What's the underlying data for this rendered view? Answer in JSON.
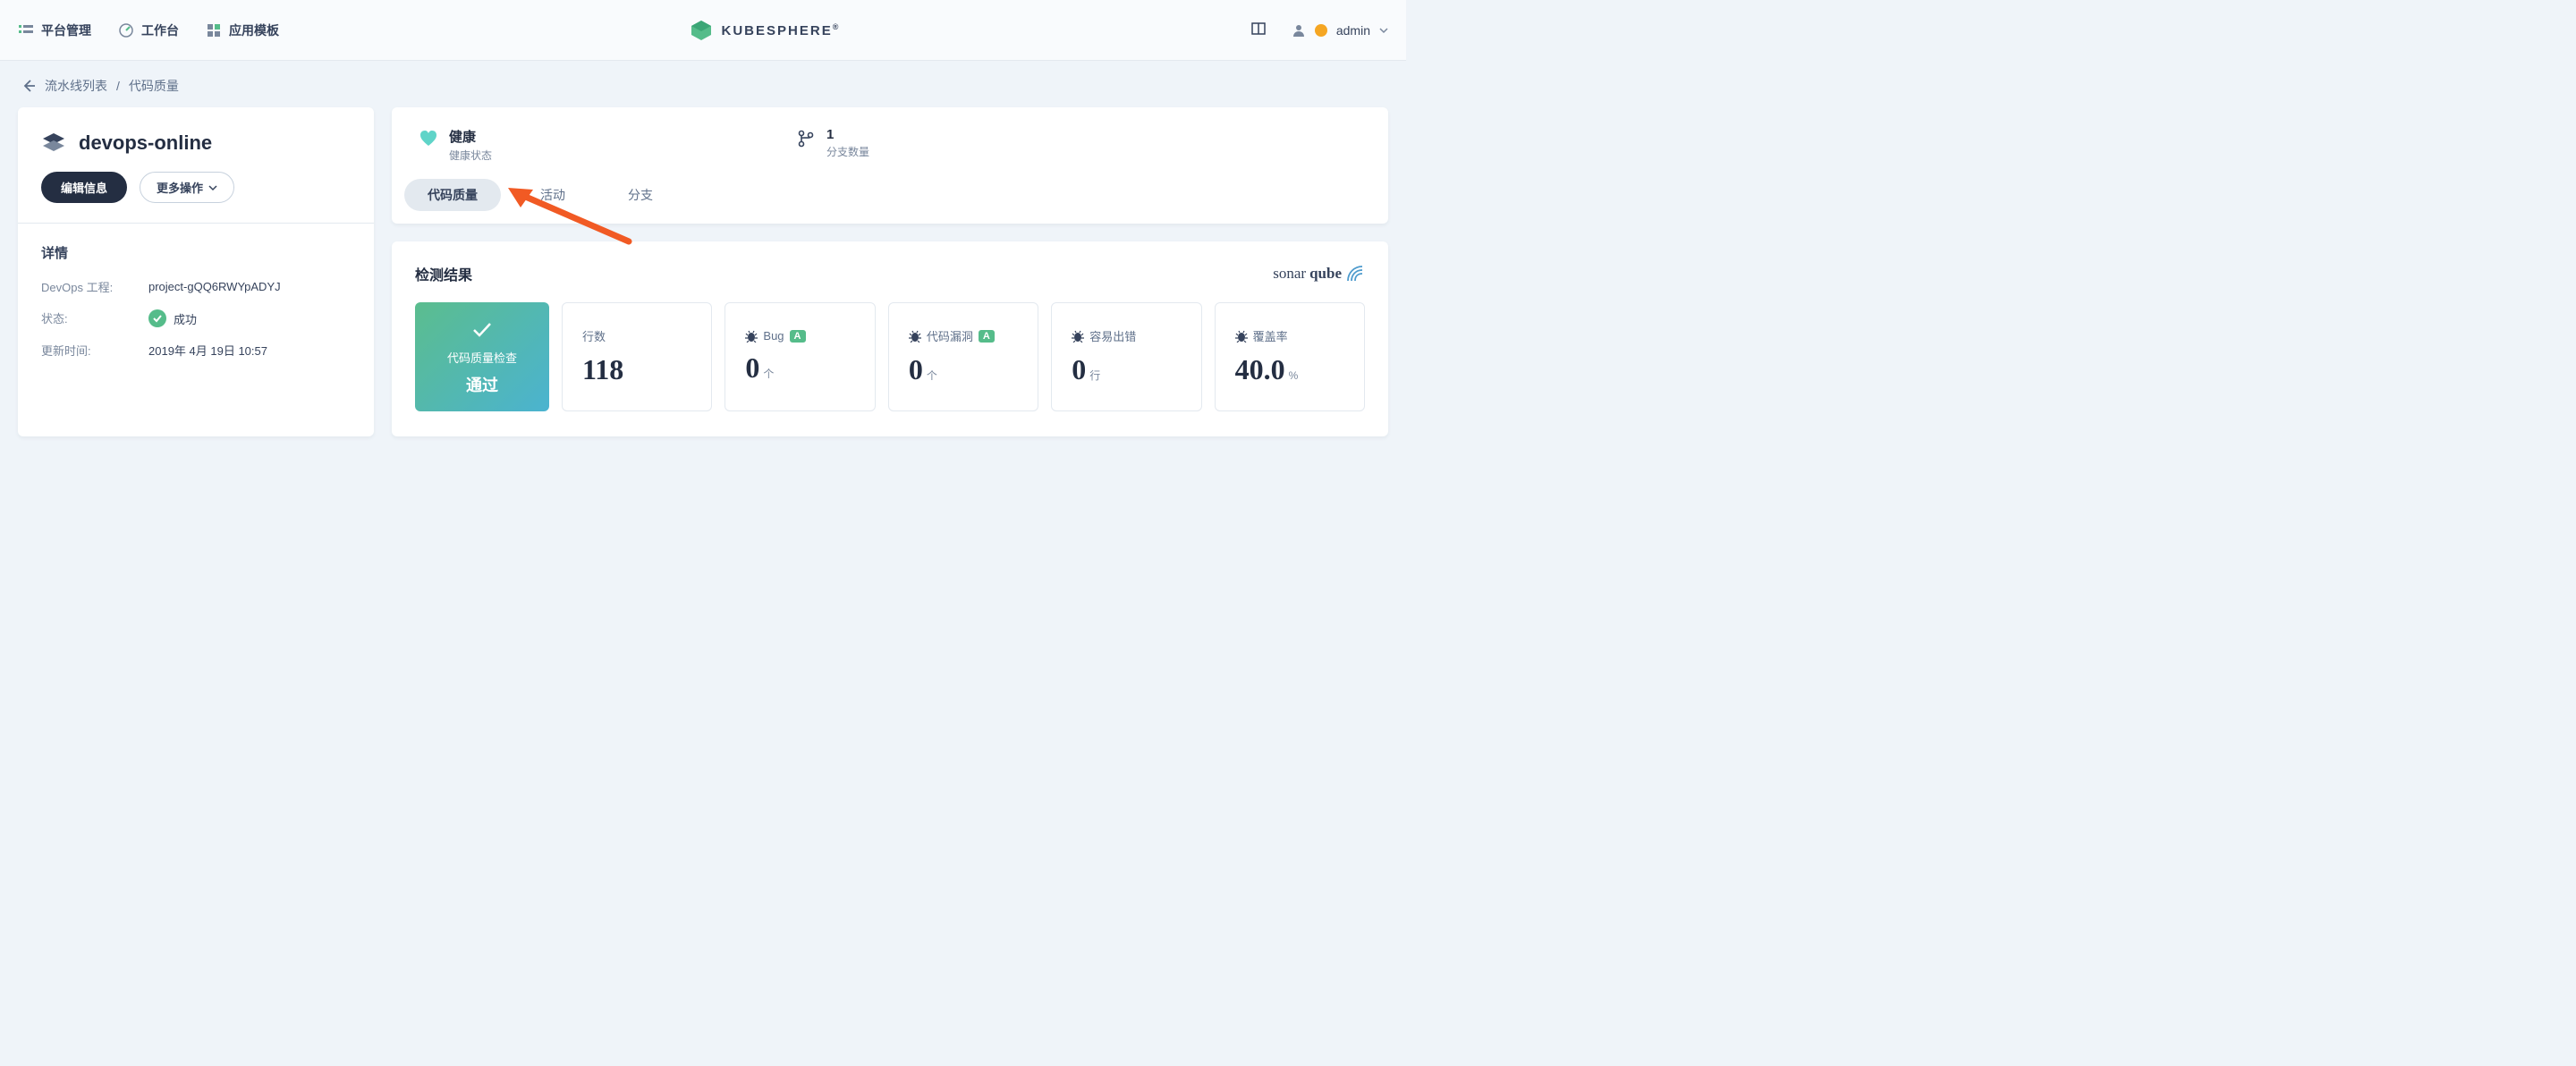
{
  "topnav": {
    "items": [
      {
        "label": "平台管理"
      },
      {
        "label": "工作台"
      },
      {
        "label": "应用模板"
      }
    ],
    "brand": "KUBESPHERE",
    "user": "admin"
  },
  "breadcrumb": {
    "parent": "流水线列表",
    "current": "代码质量",
    "sep": "/"
  },
  "sidebar": {
    "title": "devops-online",
    "edit_btn": "编辑信息",
    "more_btn": "更多操作",
    "details_heading": "详情",
    "rows": {
      "devops_label": "DevOps 工程:",
      "devops_val": "project-gQQ6RWYpADYJ",
      "status_label": "状态:",
      "status_val": "成功",
      "updated_label": "更新时间:",
      "updated_val": "2019年 4月 19日 10:57"
    }
  },
  "header": {
    "health_title": "健康",
    "health_sub": "健康状态",
    "branch_count": "1",
    "branch_sub": "分支数量"
  },
  "tabs": [
    {
      "label": "代码质量",
      "active": true
    },
    {
      "label": "活动"
    },
    {
      "label": "分支"
    }
  ],
  "results": {
    "title": "检测结果",
    "sonar1": "sonar",
    "sonar2": "qube",
    "pass_line1": "代码质量检查",
    "pass_line2": "通过",
    "metrics": [
      {
        "label": "行数",
        "value": "118",
        "unit": ""
      },
      {
        "label": "Bug",
        "value": "0",
        "unit": "个",
        "bug": true,
        "grade": "A"
      },
      {
        "label": "代码漏洞",
        "value": "0",
        "unit": "个",
        "bug": true,
        "grade": "A"
      },
      {
        "label": "容易出错",
        "value": "0",
        "unit": "行",
        "bug": true
      },
      {
        "label": "覆盖率",
        "value": "40.0",
        "unit": "%",
        "bug": true
      }
    ]
  }
}
